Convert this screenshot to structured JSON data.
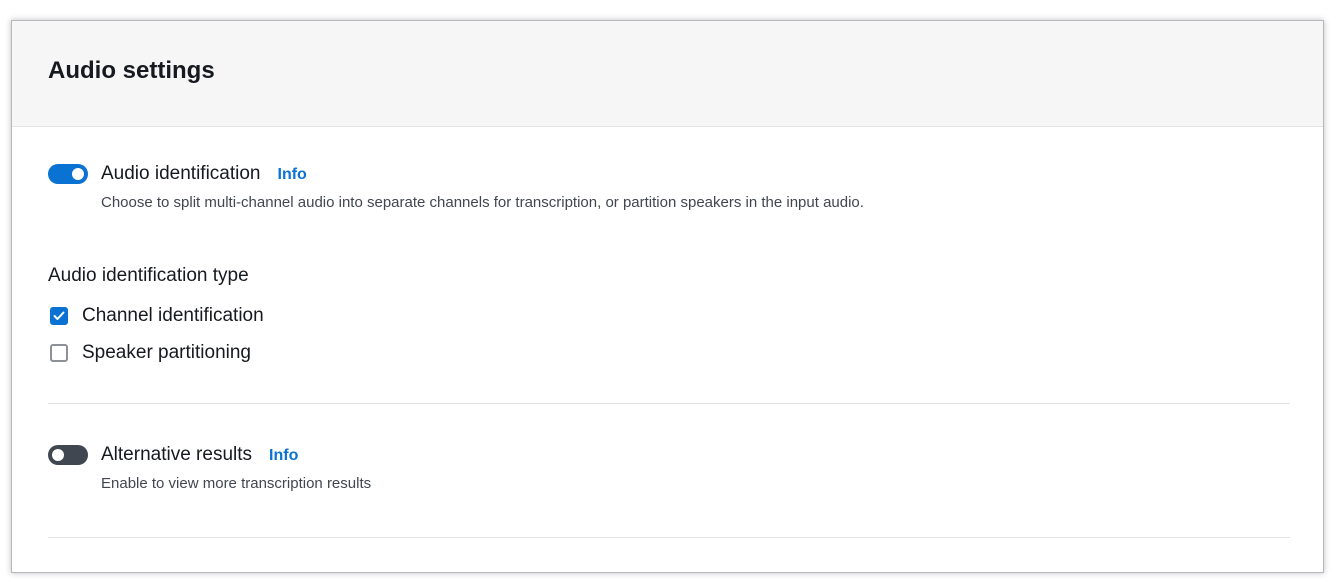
{
  "panel": {
    "title": "Audio settings"
  },
  "audio_identification": {
    "label": "Audio identification",
    "info_label": "Info",
    "description": "Choose to split multi-channel audio into separate channels for transcription, or partition speakers in the input audio.",
    "enabled": true
  },
  "identification_type": {
    "label": "Audio identification type",
    "options": [
      {
        "label": "Channel identification",
        "checked": true
      },
      {
        "label": "Speaker partitioning",
        "checked": false
      }
    ]
  },
  "alternative_results": {
    "label": "Alternative results",
    "info_label": "Info",
    "description": "Enable to view more transcription results",
    "enabled": false
  },
  "colors": {
    "accent": "#0972d3",
    "toggle_off": "#414750",
    "header_bg": "#f6f6f7",
    "divider": "#e2e3e5"
  }
}
